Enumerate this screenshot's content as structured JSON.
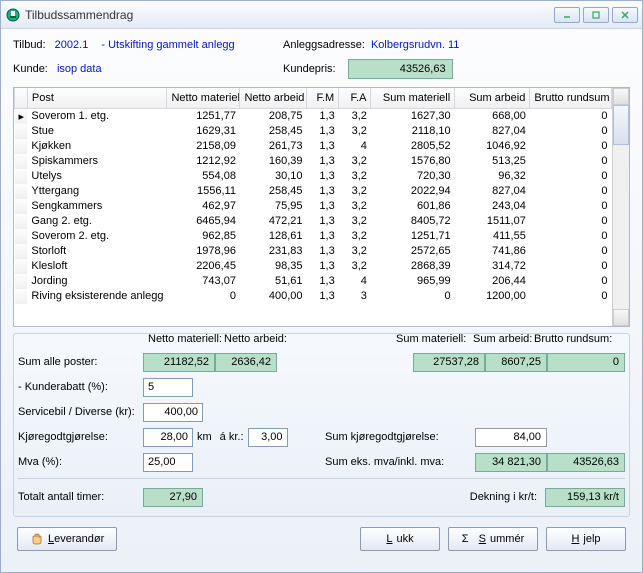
{
  "window": {
    "title": "Tilbudssammendrag"
  },
  "header": {
    "tilbud_label": "Tilbud:",
    "tilbud_no": "2002.1",
    "tilbud_desc": "- Utskifting gammelt anlegg",
    "anlegg_label": "Anleggsadresse:",
    "anlegg_val": "Kolbergsrudvn. 11",
    "kunde_label": "Kunde:",
    "kunde_val": "isop data",
    "kundepris_label": "Kundepris:",
    "kundepris_val": "43526,63"
  },
  "columns": {
    "post": "Post",
    "netto_mat": "Netto materiell",
    "netto_arb": "Netto arbeid",
    "fm": "F.M",
    "fa": "F.A",
    "sum_mat": "Sum materiell",
    "sum_arb": "Sum arbeid",
    "brutto": "Brutto rundsum"
  },
  "rows": [
    {
      "post": "Soverom 1. etg.",
      "nm": "1251,77",
      "na": "208,75",
      "fm": "1,3",
      "fa": "3,2",
      "sm": "1627,30",
      "sa": "668,00",
      "br": "0"
    },
    {
      "post": "Stue",
      "nm": "1629,31",
      "na": "258,45",
      "fm": "1,3",
      "fa": "3,2",
      "sm": "2118,10",
      "sa": "827,04",
      "br": "0"
    },
    {
      "post": "Kjøkken",
      "nm": "2158,09",
      "na": "261,73",
      "fm": "1,3",
      "fa": "4",
      "sm": "2805,52",
      "sa": "1046,92",
      "br": "0"
    },
    {
      "post": "Spiskammers",
      "nm": "1212,92",
      "na": "160,39",
      "fm": "1,3",
      "fa": "3,2",
      "sm": "1576,80",
      "sa": "513,25",
      "br": "0"
    },
    {
      "post": "Utelys",
      "nm": "554,08",
      "na": "30,10",
      "fm": "1,3",
      "fa": "3,2",
      "sm": "720,30",
      "sa": "96,32",
      "br": "0"
    },
    {
      "post": "Yttergang",
      "nm": "1556,11",
      "na": "258,45",
      "fm": "1,3",
      "fa": "3,2",
      "sm": "2022,94",
      "sa": "827,04",
      "br": "0"
    },
    {
      "post": "Sengkammers",
      "nm": "462,97",
      "na": "75,95",
      "fm": "1,3",
      "fa": "3,2",
      "sm": "601,86",
      "sa": "243,04",
      "br": "0"
    },
    {
      "post": "Gang 2. etg.",
      "nm": "6465,94",
      "na": "472,21",
      "fm": "1,3",
      "fa": "3,2",
      "sm": "8405,72",
      "sa": "1511,07",
      "br": "0"
    },
    {
      "post": "Soverom 2. etg.",
      "nm": "962,85",
      "na": "128,61",
      "fm": "1,3",
      "fa": "3,2",
      "sm": "1251,71",
      "sa": "411,55",
      "br": "0"
    },
    {
      "post": "Storloft",
      "nm": "1978,96",
      "na": "231,83",
      "fm": "1,3",
      "fa": "3,2",
      "sm": "2572,65",
      "sa": "741,86",
      "br": "0"
    },
    {
      "post": "Klesloft",
      "nm": "2206,45",
      "na": "98,35",
      "fm": "1,3",
      "fa": "3,2",
      "sm": "2868,39",
      "sa": "314,72",
      "br": "0"
    },
    {
      "post": "Jording",
      "nm": "743,07",
      "na": "51,61",
      "fm": "1,3",
      "fa": "4",
      "sm": "965,99",
      "sa": "206,44",
      "br": "0"
    },
    {
      "post": "Riving eksisterende anlegg",
      "nm": "0",
      "na": "400,00",
      "fm": "1,3",
      "fa": "3",
      "sm": "0",
      "sa": "1200,00",
      "br": "0"
    }
  ],
  "summary": {
    "hdr_nm": "Netto materiell:",
    "hdr_na": "Netto arbeid:",
    "hdr_sm": "Sum materiell:",
    "hdr_sa": "Sum arbeid:",
    "hdr_br": "Brutto rundsum:",
    "sum_poster_label": "Sum alle poster:",
    "nm_total": "21182,52",
    "na_total": "2636,42",
    "sm_total": "27537,28",
    "sa_total": "8607,25",
    "br_total": "0",
    "kunderabatt_label": "- Kunderabatt (%):",
    "kunderabatt_val": "5",
    "servicebil_label": "Servicebil / Diverse (kr):",
    "servicebil_val": "400,00",
    "kjore_label": "Kjøregodtgjørelse:",
    "kjore_km": "28,00",
    "km_unit": "km",
    "akr_label": "á kr.:",
    "kjore_rate": "3,00",
    "sum_kjore_label": "Sum kjøregodtgjørelse:",
    "sum_kjore_val": "84,00",
    "mva_label": "Mva (%):",
    "mva_val": "25,00",
    "sum_eks_label": "Sum eks. mva/inkl. mva:",
    "sum_eks_val": "34 821,30",
    "sum_inkl_val": "43526,63",
    "timer_label": "Totalt antall timer:",
    "timer_val": "27,90",
    "dekning_label": "Dekning i kr/t:",
    "dekning_val": "159,13 kr/t"
  },
  "buttons": {
    "leverandor": "Leverandør",
    "lukk": "Lukk",
    "summer": "Summér",
    "hjelp": "Hjelp"
  }
}
